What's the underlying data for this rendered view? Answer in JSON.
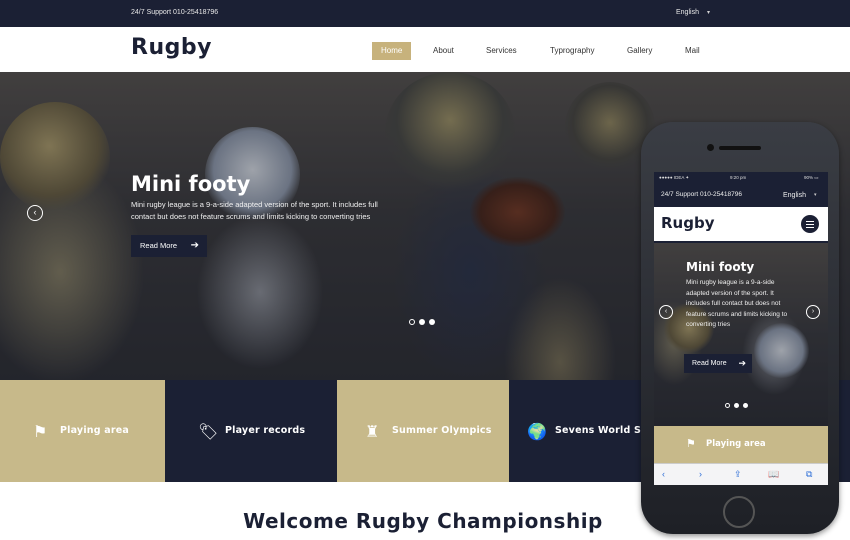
{
  "topbar": {
    "support": "24/7 Support 010-25418796",
    "language": "English",
    "caret": "▾"
  },
  "header": {
    "logo": "Rugby",
    "nav": [
      {
        "label": "Home",
        "active": true
      },
      {
        "label": "About",
        "active": false
      },
      {
        "label": "Services",
        "active": false
      },
      {
        "label": "Typrography",
        "active": false
      },
      {
        "label": "Gallery",
        "active": false
      },
      {
        "label": "Mail",
        "active": false
      }
    ]
  },
  "hero": {
    "title": "Mini footy",
    "text": "Mini rugby league is a 9-a-side adapted version of the sport. It includes full contact but does not feature scrums and limits kicking to converting tries",
    "read_more": "Read More",
    "arrow": "➔",
    "prev": "‹",
    "slides": 3,
    "active_slide": 2
  },
  "features": [
    {
      "label": "Playing area",
      "icon": "flag-icon",
      "glyph": "⚑",
      "color": "#c7b98a"
    },
    {
      "label": "Player records",
      "icon": "tag-icon",
      "glyph": "🏷",
      "color": "#1b2034"
    },
    {
      "label": "Summer Olympics",
      "icon": "tower-icon",
      "glyph": "♜",
      "color": "#c7b98a"
    },
    {
      "label": "Sevens World Se",
      "icon": "globe-icon",
      "glyph": "🌍",
      "color": "#1b2034"
    }
  ],
  "welcome": {
    "title": "Welcome Rugby Championship"
  },
  "phone": {
    "status": {
      "carrier": "●●●●● IDEA ✦",
      "time": "9:20 pm",
      "battery": "90% ▭"
    },
    "support": "24/7 Support 010-25418796",
    "language": "English",
    "caret": "▾",
    "logo": "Rugby",
    "hero": {
      "title": "Mini footy",
      "text": "Mini rugby league is a 9-a-side adapted version of the sport. It includes full contact but does not feature scrums and limits kicking to converting tries",
      "read_more": "Read More",
      "arrow": "➔",
      "prev": "‹",
      "next": "›"
    },
    "feature": {
      "label": "Playing area",
      "icon": "flag-icon",
      "glyph": "⚑"
    },
    "toolbar": [
      "‹",
      "›",
      "⇪",
      "📖",
      "⧉"
    ]
  },
  "colors": {
    "navy": "#1b2034",
    "gold": "#c7b98a",
    "nav_active": "#c7b27c"
  }
}
